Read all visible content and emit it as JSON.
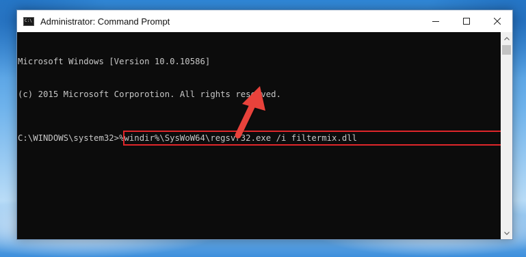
{
  "window": {
    "title": "Administrator: Command Prompt",
    "icon": "cmd-icon",
    "icon_glyph": "C:\\"
  },
  "controls": {
    "minimize_icon": "minimize-icon",
    "maximize_icon": "maximize-icon",
    "close_icon": "close-icon"
  },
  "console": {
    "lines": [
      "Microsoft Windows [Version 10.0.10586]",
      "(c) 2015 Microsoft Corporotion. All rights reserved."
    ],
    "prompt": "C:\\WINDOWS\\system32>",
    "command": "%windir%\\SysWoW64\\regsvr32.exe /i filtermix.dll"
  },
  "annotation": {
    "highlight_color": "#e0262a",
    "arrow_color": "#e8423a",
    "arrow_icon": "red-pointer-arrow"
  },
  "colors": {
    "console_bg": "#0c0c0c",
    "console_text": "#c7c7c7",
    "titlebar_bg": "#ffffff"
  }
}
